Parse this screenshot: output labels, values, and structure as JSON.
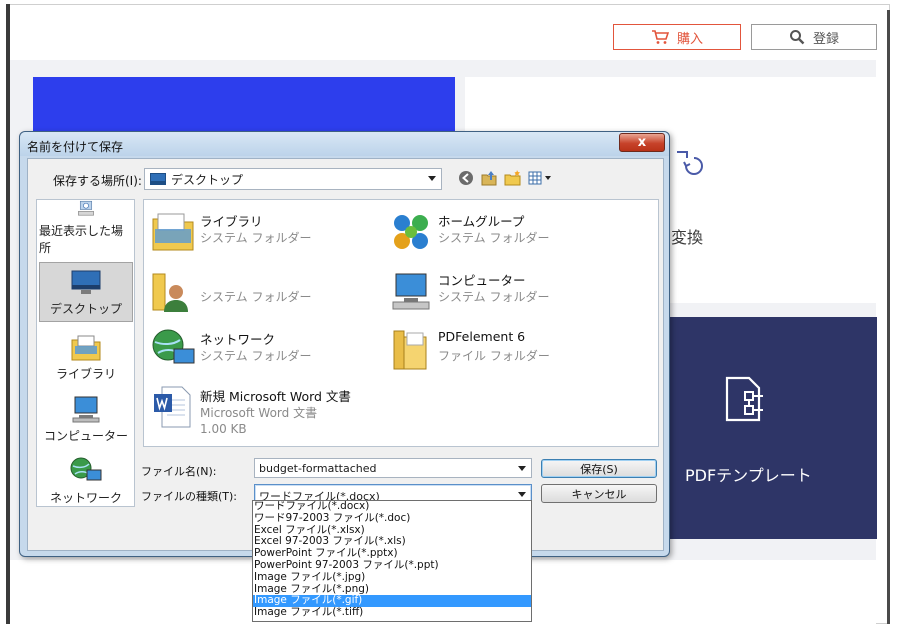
{
  "app": {
    "buy_label": "購入",
    "login_label": "登録",
    "convert_label": "変換",
    "template_label": "PDFテンプレート"
  },
  "dialog": {
    "title": "名前を付けて保存",
    "close_glyph": "x",
    "location_label": "保存する場所(I):",
    "location_value": "デスクトップ",
    "places": [
      {
        "label": "最近表示した場所",
        "icon": "recent-places-icon"
      },
      {
        "label": "デスクトップ",
        "icon": "desktop-icon"
      },
      {
        "label": "ライブラリ",
        "icon": "library-icon"
      },
      {
        "label": "コンピューター",
        "icon": "computer-icon"
      },
      {
        "label": "ネットワーク",
        "icon": "network-icon"
      }
    ],
    "files": [
      {
        "name": "ライブラリ",
        "type": "システム フォルダー",
        "icon": "library-folder-icon"
      },
      {
        "name": "ホームグループ",
        "type": "システム フォルダー",
        "icon": "homegroup-icon"
      },
      {
        "name": "",
        "type": "システム フォルダー",
        "icon": "user-folder-icon"
      },
      {
        "name": "コンピューター",
        "type": "システム フォルダー",
        "icon": "computer-icon"
      },
      {
        "name": "ネットワーク",
        "type": "システム フォルダー",
        "icon": "network-icon"
      },
      {
        "name": "PDFelement 6",
        "type": "ファイル フォルダー",
        "icon": "folder-icon"
      },
      {
        "name": "新規 Microsoft Word 文書",
        "type": "Microsoft Word 文書",
        "size": "1.00 KB",
        "icon": "word-document-icon"
      }
    ],
    "filename_label": "ファイル名(N):",
    "filename_value": "budget-formattached",
    "filetype_label": "ファイルの種類(T):",
    "filetype_value": "ワードファイル(*.docx)",
    "save_label": "保存(S)",
    "cancel_label": "キャンセル",
    "filetype_options": [
      "ワードファイル(*.docx)",
      "ワード97-2003 ファイル(*.doc)",
      "Excel ファイル(*.xlsx)",
      "Excel 97-2003 ファイル(*.xls)",
      "PowerPoint ファイル(*.pptx)",
      "PowerPoint 97-2003 ファイル(*.ppt)",
      "Image ファイル(*.jpg)",
      "Image ファイル(*.png)",
      "Image ファイル(*.gif)",
      "Image ファイル(*.tiff)"
    ],
    "highlighted_option_index": 8
  },
  "colors": {
    "buy_accent": "#e2553c",
    "primary_blue": "#2d3eed",
    "navy_card": "#2e3567",
    "dropdown_highlight": "#3399ff"
  }
}
